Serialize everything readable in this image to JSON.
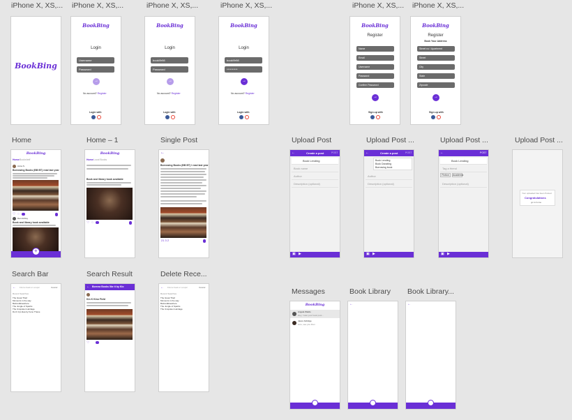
{
  "labels": {
    "top": [
      "iPhone X, XS,...",
      "iPhone X, XS,...",
      "iPhone X, XS,...",
      "iPhone X, XS,...",
      "iPhone X, XS,...",
      "iPhone X, XS,..."
    ],
    "row2": [
      "Home",
      "Home – 1",
      "Single Post",
      "Upload Post",
      "Upload Post ...",
      "Upload Post ...",
      "Upload Post ..."
    ],
    "row3": [
      "Search Bar",
      "Search Result",
      "Delete Rece...",
      "Messages",
      "Book Library",
      "Book Library..."
    ]
  },
  "brand": {
    "logo": "BookBing",
    "accent": "#6a2fd6"
  },
  "login": {
    "title": "Login",
    "user_placeholder": "Username",
    "pass_placeholder": "Password",
    "user_value": "bookl9r98",
    "pass_value": "**********",
    "pass_typing": "Password",
    "register_prompt": "No account?",
    "register_link": "Register",
    "login_with": "Login with"
  },
  "register": {
    "title": "Register",
    "fields": [
      "Name",
      "Email",
      "Username",
      "Password",
      "Confirm Password"
    ],
    "sub": "Book Your Address",
    "addr_fields": [
      "Street no / Apartment",
      "Street",
      "City",
      "State",
      "Zipcode"
    ],
    "signup_with": "Sign up with"
  },
  "home": {
    "tabs": [
      "Home",
      "Bookshelf"
    ],
    "post_user": "Anna S.",
    "post_title": "Borrowing Books (BB BT) read last year",
    "post2_title": "Book and library book available",
    "post2_user": "Dan Ashley"
  },
  "home1": {
    "tab": "Home",
    "tab2": "Local Books",
    "post_title": "Book and library book available"
  },
  "single": {
    "post_title": "Borrowing Books (BB BT) I read last year",
    "stats": "21 3 2"
  },
  "upload": {
    "header": "Create a post",
    "post_btn": "POST",
    "field_title": "Book Lending",
    "options": [
      "Book Lending",
      "Book Donating",
      "Borrowing book"
    ],
    "field2": "Book name",
    "field3": "Author",
    "field4": "Tag a friend",
    "desc": "Description (optional)",
    "genre": "Fiction",
    "genre2": "Academic"
  },
  "uploaded": {
    "note": "Your uploaded has been Posted",
    "congrats": "Congratulations",
    "action": "go to home"
  },
  "search": {
    "placeholder": "Find a book or a topic",
    "cancel": "Cancel",
    "recent_label": "Recent Searches",
    "recent": [
      "The Great Thief",
      "Moments in the way",
      "Before/Elsewhere",
      "The Jungle of Sparks",
      "The Unspoken Heritage",
      "Don't tryt idea by Feno Thane"
    ]
  },
  "search_result": {
    "header": "Borrow Books like it by Kio",
    "title": "Kin K Kino Field"
  },
  "delete_recent": {
    "placeholder": "Find a book or a topic",
    "cancel": "Cancel",
    "recent_label": "Recent Searches",
    "recent": [
      "The Great Thief",
      "Moments in the way",
      "Before/Elsewhere",
      "The Jungle of Sparks",
      "The Unspoken Heritage"
    ]
  },
  "messages": {
    "items": [
      {
        "name": "Angela Waldo",
        "preview": "Hey, I saw your book post..."
      },
      {
        "name": "Jason Aldridge",
        "preview": "sure, see you then"
      }
    ]
  }
}
